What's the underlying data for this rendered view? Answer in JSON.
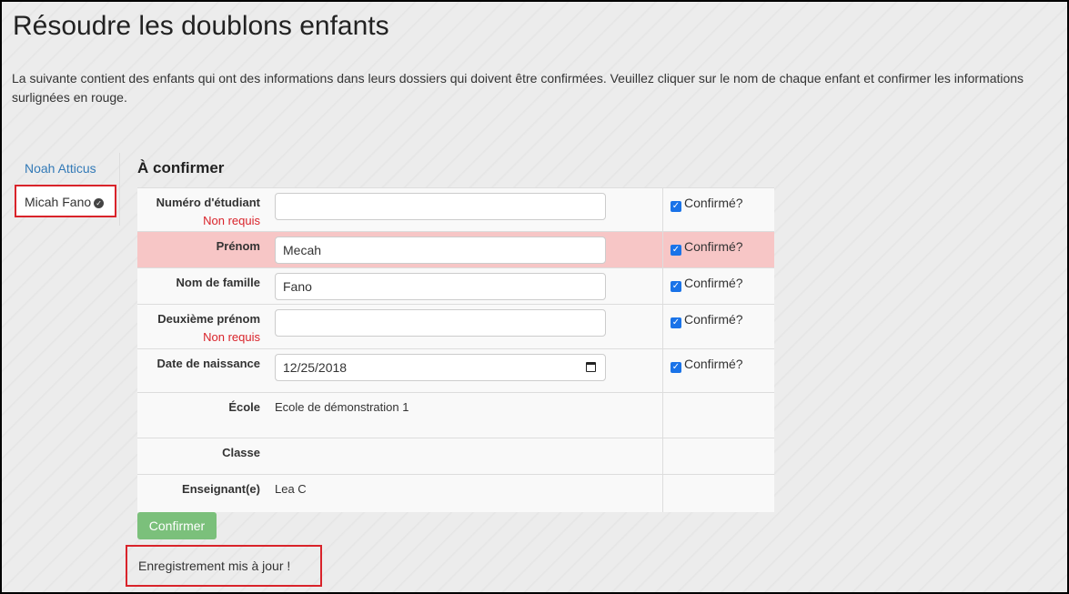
{
  "page": {
    "title": "Résoudre les doublons enfants",
    "intro": "La suivante contient des enfants qui ont des informations dans leurs dossiers qui doivent être confirmées. Veuillez cliquer sur le nom de chaque enfant et confirmer les informations surlignées en rouge."
  },
  "sidebar": {
    "items": [
      {
        "label": "Noah Atticus"
      },
      {
        "label": "Micah Fano",
        "icon": "check-circle-icon"
      }
    ]
  },
  "section": {
    "title": "À confirmer"
  },
  "form": {
    "confirm_label": "Confirmé?",
    "not_required": "Non requis",
    "rows": [
      {
        "label": "Numéro d'étudiant",
        "value": "",
        "required_note": "Non requis",
        "confirmed": true
      },
      {
        "label": "Prénom",
        "value": "Mecah",
        "confirmed": true,
        "highlight": true
      },
      {
        "label": "Nom de famille",
        "value": "Fano",
        "confirmed": true
      },
      {
        "label": "Deuxième prénom",
        "value": "",
        "required_note": "Non requis",
        "confirmed": true
      },
      {
        "label": "Date de naissance",
        "value": "12/25/2018",
        "confirmed": true
      },
      {
        "label": "École",
        "value": "Ecole de démonstration 1"
      },
      {
        "label": "Classe",
        "value": ""
      },
      {
        "label": "Enseignant(e)",
        "value": "Lea C"
      }
    ]
  },
  "actions": {
    "confirm_button": "Confirmer"
  },
  "status": {
    "message": "Enregistrement mis à jour !"
  },
  "colors": {
    "highlight_row": "#f7c6c6",
    "annotation_border": "#d9232a",
    "link": "#337ab7",
    "button": "#7bc07b"
  }
}
